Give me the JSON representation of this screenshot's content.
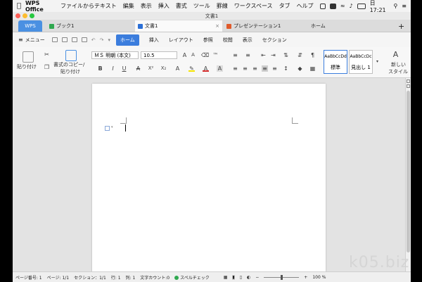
{
  "menubar": {
    "app_name": "WPS Office",
    "items": [
      "ファイルからテキスト",
      "編集",
      "表示",
      "挿入",
      "書式",
      "ツール",
      "罫線",
      "ワークスペース",
      "タブ",
      "ヘルプ"
    ],
    "clock": "日 17:21"
  },
  "window": {
    "title": "文書1"
  },
  "tabs": [
    {
      "label": "WPS"
    },
    {
      "label": "ブック1",
      "color": "#2fa84f"
    },
    {
      "label": "文書1",
      "color": "#2b6fd6"
    },
    {
      "label": "プレゼンテーション1",
      "color": "#e05a2b"
    },
    {
      "label": "ホーム"
    }
  ],
  "new_tab": "+",
  "menu_row": {
    "menu_label": "メニュー",
    "items": [
      "ホーム",
      "挿入",
      "レイアウト",
      "参照",
      "校閲",
      "表示",
      "セクション"
    ]
  },
  "ribbon": {
    "paste": "貼り付け",
    "format_painter_1": "書式のコピー/",
    "format_painter_2": "貼り付け",
    "font_name": "ＭＳ 明朝 (本文)",
    "font_size": "10.5",
    "style_normal_preview": "AaBbCcDd",
    "style_normal_name": "標準",
    "style_heading_preview": "AaBbCcDc",
    "style_heading_name": "見出し 1",
    "new_style_1": "新しい",
    "new_style_2": "スタイル"
  },
  "status": {
    "page_number": "ページ番号: 1",
    "page": "ページ: 1/1",
    "section": "セクション：1/1",
    "line": "行: 1",
    "column": "列: 1",
    "word_count": "文字カウント:0",
    "spell_check": "スペルチェック",
    "zoom": "100 %"
  },
  "watermark": "k05.biz",
  "colors": {
    "accent": "#3b7ddd",
    "wps_tab": "#4a90e2"
  }
}
